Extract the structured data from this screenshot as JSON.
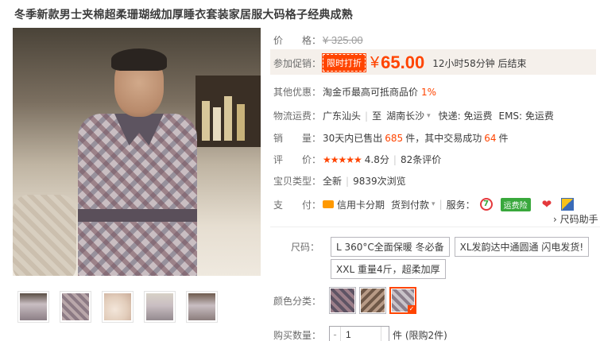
{
  "title": "冬季新款男士夹棉超柔珊瑚绒加厚睡衣套装家居服大码格子经典成熟",
  "price": {
    "label": "价　　格：",
    "original": "¥ 325.00"
  },
  "promo": {
    "label": "参加促销：",
    "tag": "限时打折",
    "currency": "¥",
    "value": "65.00",
    "countdown": "12小时58分钟 后结束"
  },
  "other_offer": {
    "label": "其他优惠：",
    "text": "淘金币最高可抵商品价",
    "percent": "1%"
  },
  "shipping": {
    "label": "物流运费：",
    "from": "广东汕头",
    "to_prefix": "至",
    "to": "湖南长沙",
    "express": "快递: 免运费",
    "ems": "EMS: 免运费"
  },
  "sales": {
    "label": "销　　量：",
    "prefix": "30天内已售出",
    "sold": "685",
    "mid": "件，其中交易成功",
    "success": "64",
    "suffix": "件"
  },
  "rating": {
    "label": "评　　价：",
    "stars": "★★★★★",
    "score": "4.8分",
    "reviews": "82条评价"
  },
  "item_type": {
    "label": "宝贝类型：",
    "condition": "全新",
    "views": "9839次浏览"
  },
  "payment": {
    "label": "支　　付：",
    "installment": "信用卡分期",
    "cod": "货到付款",
    "service_label": "服务：",
    "service_7": "7",
    "service_badge": "运费险"
  },
  "size_helper": "› 尺码助手",
  "size": {
    "label": "尺码：",
    "options": [
      "L 360°C全面保暖 冬必备",
      "XL发韵达中通圆通 闪电发货!",
      "XXL 重量4斤，超柔加厚"
    ]
  },
  "color": {
    "label": "颜色分类："
  },
  "quantity": {
    "label": "购买数量：",
    "value": "1",
    "limit": "件 (限购2件)"
  }
}
